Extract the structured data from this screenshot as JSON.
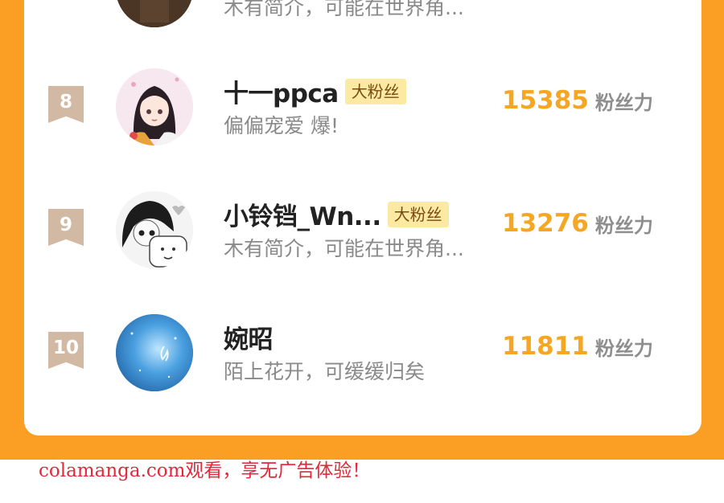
{
  "ranking": {
    "partial_top_bio": "木有简介，可能在世界角...",
    "rows": [
      {
        "rank": "8",
        "name": "十一ppca",
        "badge": "大粉丝",
        "bio": "偏偏宠爱 爆!",
        "score": "15385",
        "score_unit": "粉丝力",
        "avatar": "anime-girl-avatar"
      },
      {
        "rank": "9",
        "name": "小铃铛_Wn...",
        "badge": "大粉丝",
        "bio": "木有简介，可能在世界角...",
        "score": "13276",
        "score_unit": "粉丝力",
        "avatar": "monochrome-anime-avatar"
      },
      {
        "rank": "10",
        "name": "婉昭",
        "badge": "",
        "bio": "陌上花开，可缓缓归矣",
        "score": "11811",
        "score_unit": "粉丝力",
        "avatar": "blue-underwater-avatar"
      }
    ]
  },
  "watermark": "colamanga.com观看，享无广告体验！",
  "colors": {
    "frame": "#fb9f24",
    "score": "#f5a623",
    "badge_bg": "#fdeaa2",
    "rank_ribbon": "#d2b9a3",
    "watermark": "#e3283a"
  }
}
